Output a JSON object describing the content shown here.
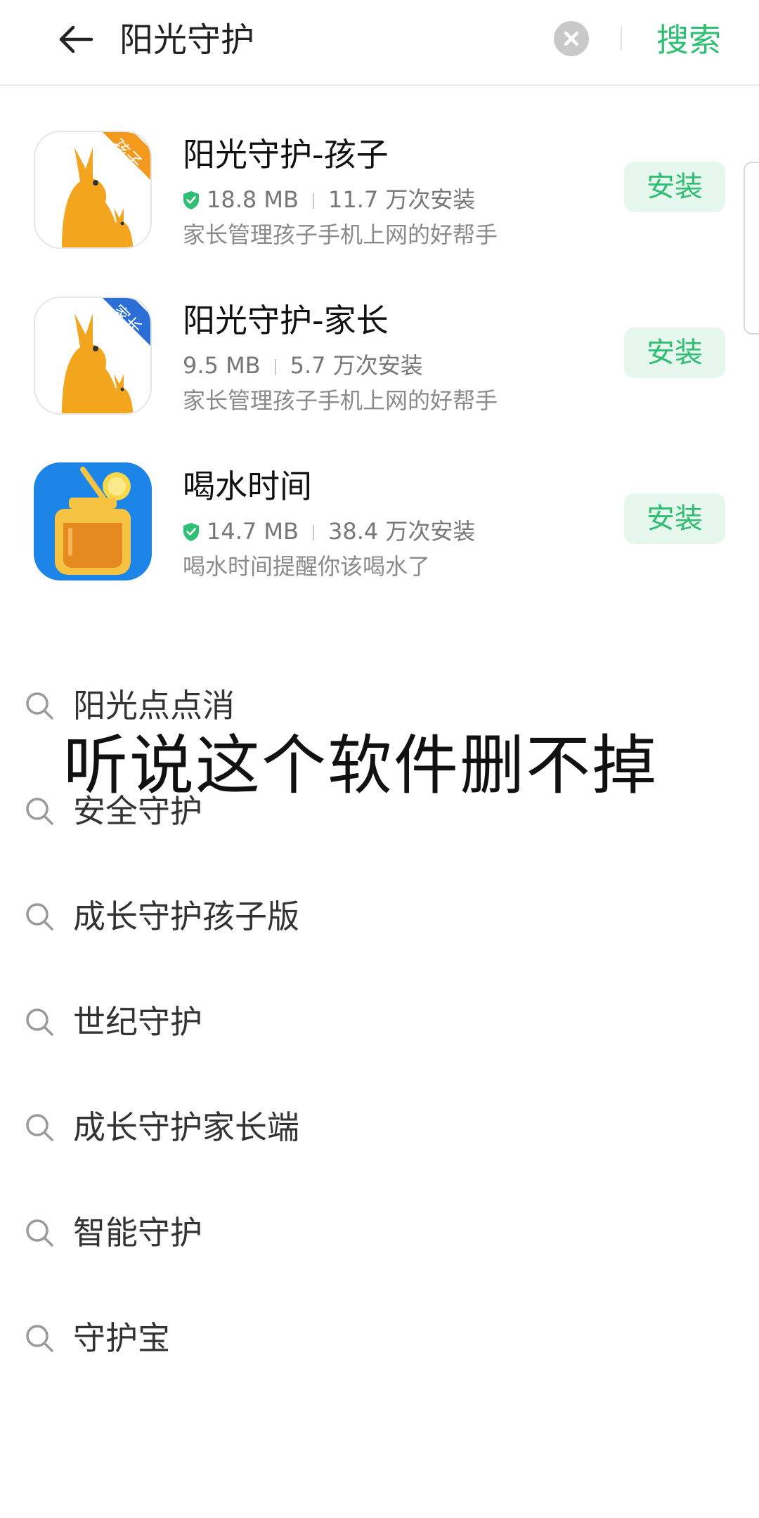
{
  "search": {
    "query": "阳光守护",
    "submit_label": "搜索"
  },
  "colors": {
    "accent": "#2fbf72",
    "install_bg": "#e6f8ee",
    "shield": "#2fbf72"
  },
  "apps": [
    {
      "name": "阳光守护-孩子",
      "verified": true,
      "size": "18.8 MB",
      "installs": "11.7 万次安装",
      "description": "家长管理孩子手机上网的好帮手",
      "badge": "孩子",
      "icon": "kangaroo-icon",
      "install_label": "安装"
    },
    {
      "name": "阳光守护-家长",
      "verified": false,
      "size": "9.5 MB",
      "installs": "5.7 万次安装",
      "description": "家长管理孩子手机上网的好帮手",
      "badge": "家长",
      "icon": "kangaroo-icon",
      "install_label": "安装"
    },
    {
      "name": "喝水时间",
      "verified": true,
      "size": "14.7 MB",
      "installs": "38.4 万次安装",
      "description": "喝水时间提醒你该喝水了",
      "icon": "juice-jar-icon",
      "install_label": "安装"
    }
  ],
  "suggestions": [
    "阳光点点消",
    "安全守护",
    "成长守护孩子版",
    "世纪守护",
    "成长守护家长端",
    "智能守护",
    "守护宝"
  ],
  "caption": "听说这个软件删不掉"
}
